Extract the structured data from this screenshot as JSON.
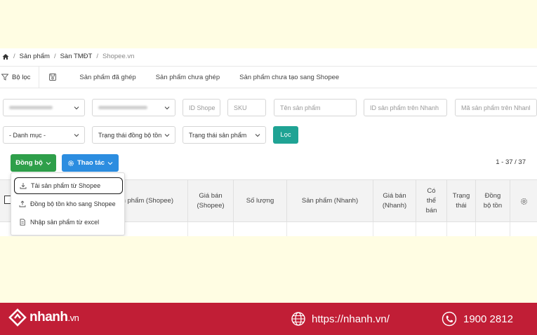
{
  "breadcrumb": {
    "items": [
      "Sản phẩm",
      "Sàn TMĐT"
    ],
    "current": "Shopee.vn"
  },
  "tabs": [
    {
      "label": "Bộ lọc"
    },
    {
      "label": ""
    },
    {
      "label": "Sản phẩm đã ghép"
    },
    {
      "label": "Sản phẩm chưa ghép"
    },
    {
      "label": "Sản phẩm chưa tạo sang Shopee"
    }
  ],
  "filters": {
    "shop_select": "",
    "brand_select": "",
    "id_shopee_placeholder": "ID Shope",
    "sku_placeholder": "SKU",
    "product_name_placeholder": "Tên sản phẩm",
    "nhanh_id_placeholder": "ID sản phẩm trên Nhanh",
    "nhanh_code_placeholder": "Mã sản phẩm trên Nhanl",
    "category_select": "- Danh mục -",
    "stock_sync_status": "Trạng thái đồng bộ tồn",
    "product_status": "Trạng thái sản phẩm",
    "filter_button": "Lọc"
  },
  "toolbar": {
    "sync_label": "Đồng bộ",
    "actions_label": "Thao tác",
    "pagination": "1 - 37 / 37"
  },
  "dropdown": {
    "items": [
      {
        "label": "Tải sản phẩm từ Shopee"
      },
      {
        "label": "Đồng bộ tồn kho sang Shopee"
      },
      {
        "label": "Nhập sản phẩm từ excel"
      }
    ]
  },
  "table": {
    "headers": {
      "product_shopee": "n phẩm (Shopee)",
      "price_shopee": "Giá bán\n(Shopee)",
      "quantity": "Số lượng",
      "product_nhanh": "Sản phẩm (Nhanh)",
      "price_nhanh": "Giá bán\n(Nhanh)",
      "available": "Có\nthể\nbán",
      "status": "Trạng\nthái",
      "stock_sync": "Đồng\nbộ tồn"
    }
  },
  "footer": {
    "brand": "nhanh",
    "brand_suffix": ".vn",
    "website": "https://nhanh.vn/",
    "phone": "1900 2812"
  },
  "colors": {
    "sync_button": "#2e9f4a",
    "actions_button": "#2c8de0",
    "filter_button": "#1fa394",
    "footer": "#c11e36",
    "background": "#fffde3"
  }
}
